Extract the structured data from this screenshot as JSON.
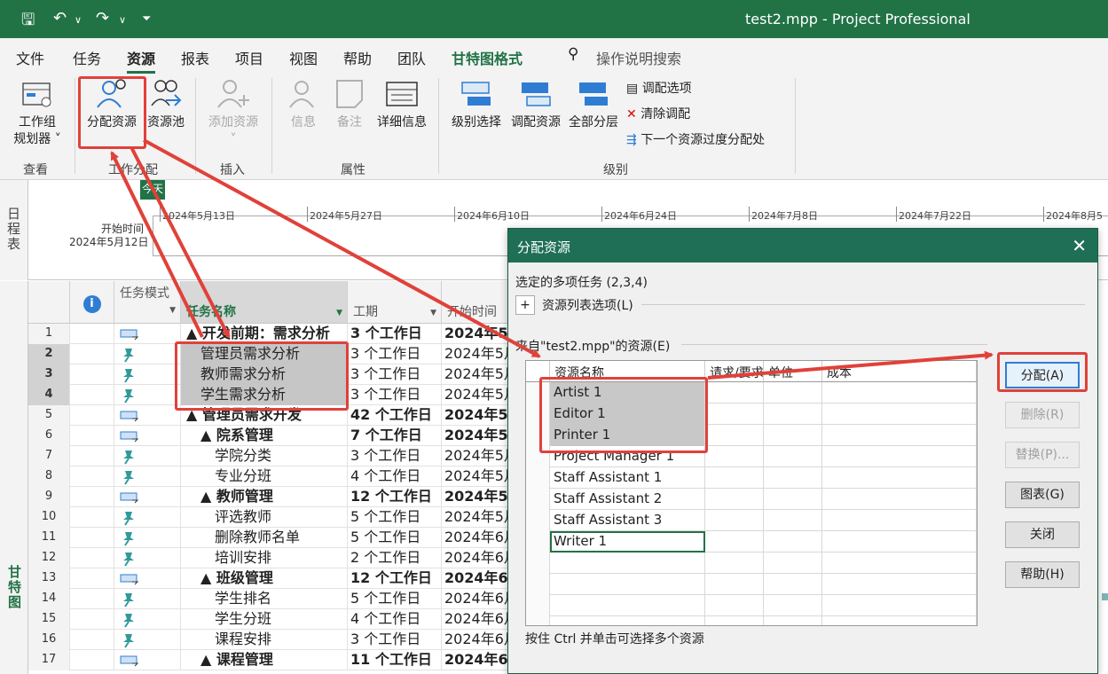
{
  "titlebar": {
    "title": "test2.mpp  -  Project Professional"
  },
  "tabs": [
    "文件",
    "任务",
    "资源",
    "报表",
    "项目",
    "视图",
    "帮助",
    "团队",
    "甘特图格式"
  ],
  "search": {
    "label": "操作说明搜索"
  },
  "ribbon": {
    "view_group": {
      "label": "查看",
      "team_planner_line1": "工作组",
      "team_planner_line2": "规划器"
    },
    "assign_group": {
      "label": "工作分配",
      "assign_resources": "分配资源",
      "resource_pool": "资源池"
    },
    "insert_group": {
      "label": "插入",
      "add_resources": "添加资源"
    },
    "props_group": {
      "label": "属性",
      "info": "信息",
      "notes": "备注",
      "details": "详细信息"
    },
    "level_group": {
      "label": "级别",
      "level_selection": "级别选择",
      "level_resource": "调配资源",
      "level_all": "全部分层",
      "leveling_options": "调配选项",
      "clear_leveling": "清除调配",
      "next_overallocation": "下一个资源过度分配处"
    }
  },
  "timeline": {
    "side_label": "日程表",
    "today_label": "今天",
    "start_label": "开始时间",
    "start_date": "2024年5月12日",
    "dates": [
      "2024年5月13日",
      "2024年5月27日",
      "2024年6月10日",
      "2024年6月24日",
      "2024年7月8日",
      "2024年7月22日",
      "2024年8月5"
    ]
  },
  "gantt_side_label": "甘特图",
  "grid": {
    "headers": {
      "mode": "任务模式",
      "name": "任务名称",
      "duration": "工期",
      "start": "开始时间"
    },
    "rows": [
      {
        "n": "1",
        "name": "▲ 开发前期：需求分析",
        "dur": "3 个工作日",
        "start": "2024年5",
        "summary": true,
        "indent": 0,
        "mode": "auto"
      },
      {
        "n": "2",
        "name": "管理员需求分析",
        "dur": "3 个工作日",
        "start": "2024年5月",
        "summary": false,
        "indent": 1,
        "mode": "manual",
        "sel": true
      },
      {
        "n": "3",
        "name": "教师需求分析",
        "dur": "3 个工作日",
        "start": "2024年5月",
        "summary": false,
        "indent": 1,
        "mode": "manual",
        "sel": true
      },
      {
        "n": "4",
        "name": "学生需求分析",
        "dur": "3 个工作日",
        "start": "2024年5月",
        "summary": false,
        "indent": 1,
        "mode": "manual",
        "sel": true
      },
      {
        "n": "5",
        "name": "▲ 管理员需求开发",
        "dur": "42 个工作日",
        "start": "2024年5,",
        "summary": true,
        "indent": 0,
        "mode": "auto"
      },
      {
        "n": "6",
        "name": "▲ 院系管理",
        "dur": "7 个工作日",
        "start": "2024年5,",
        "summary": true,
        "indent": 1,
        "mode": "auto"
      },
      {
        "n": "7",
        "name": "学院分类",
        "dur": "3 个工作日",
        "start": "2024年5月",
        "summary": false,
        "indent": 2,
        "mode": "manual"
      },
      {
        "n": "8",
        "name": "专业分班",
        "dur": "4 个工作日",
        "start": "2024年5月",
        "summary": false,
        "indent": 2,
        "mode": "manual"
      },
      {
        "n": "9",
        "name": "▲ 教师管理",
        "dur": "12 个工作日",
        "start": "2024年5,",
        "summary": true,
        "indent": 1,
        "mode": "auto"
      },
      {
        "n": "10",
        "name": "评选教师",
        "dur": "5 个工作日",
        "start": "2024年5月",
        "summary": false,
        "indent": 2,
        "mode": "manual"
      },
      {
        "n": "11",
        "name": "删除教师名单",
        "dur": "5 个工作日",
        "start": "2024年6月",
        "summary": false,
        "indent": 2,
        "mode": "manual"
      },
      {
        "n": "12",
        "name": "培训安排",
        "dur": "2 个工作日",
        "start": "2024年6月",
        "summary": false,
        "indent": 2,
        "mode": "manual"
      },
      {
        "n": "13",
        "name": "▲ 班级管理",
        "dur": "12 个工作日",
        "start": "2024年6,",
        "summary": true,
        "indent": 1,
        "mode": "auto"
      },
      {
        "n": "14",
        "name": "学生排名",
        "dur": "5 个工作日",
        "start": "2024年6月",
        "summary": false,
        "indent": 2,
        "mode": "manual"
      },
      {
        "n": "15",
        "name": "学生分班",
        "dur": "4 个工作日",
        "start": "2024年6月",
        "summary": false,
        "indent": 2,
        "mode": "manual"
      },
      {
        "n": "16",
        "name": "课程安排",
        "dur": "3 个工作日",
        "start": "2024年6月",
        "summary": false,
        "indent": 2,
        "mode": "manual"
      },
      {
        "n": "17",
        "name": "▲ 课程管理",
        "dur": "11 个工作日",
        "start": "2024年6,",
        "summary": true,
        "indent": 1,
        "mode": "auto"
      }
    ]
  },
  "dialog": {
    "title": "分配资源",
    "selected_tasks": "选定的多项任务 (2,3,4)",
    "expand": "+",
    "list_options": "资源列表选项(L)",
    "from_label": "来自\"test2.mpp\"的资源(E)",
    "columns": {
      "name": "资源名称",
      "request": "请求/要求",
      "units": "单位",
      "cost": "成本"
    },
    "resources": [
      {
        "name": "Artist 1",
        "sel": true
      },
      {
        "name": "Editor 1",
        "sel": true
      },
      {
        "name": "Printer 1",
        "sel": true
      },
      {
        "name": "Project Manager 1",
        "sel": false
      },
      {
        "name": "Staff Assistant 1",
        "sel": false
      },
      {
        "name": "Staff Assistant 2",
        "sel": false
      },
      {
        "name": "Staff Assistant 3",
        "sel": false
      },
      {
        "name": "Writer 1",
        "sel": false
      }
    ],
    "hint": "按住 Ctrl 并单击可选择多个资源",
    "buttons": {
      "assign": "分配(A)",
      "remove": "删除(R)",
      "replace": "替换(P)...",
      "graphs": "图表(G)",
      "close": "关闭",
      "help": "帮助(H)"
    }
  },
  "colors": {
    "accent": "#217346",
    "highlight": "#e0413a",
    "dialog_title": "#1e6f55"
  }
}
